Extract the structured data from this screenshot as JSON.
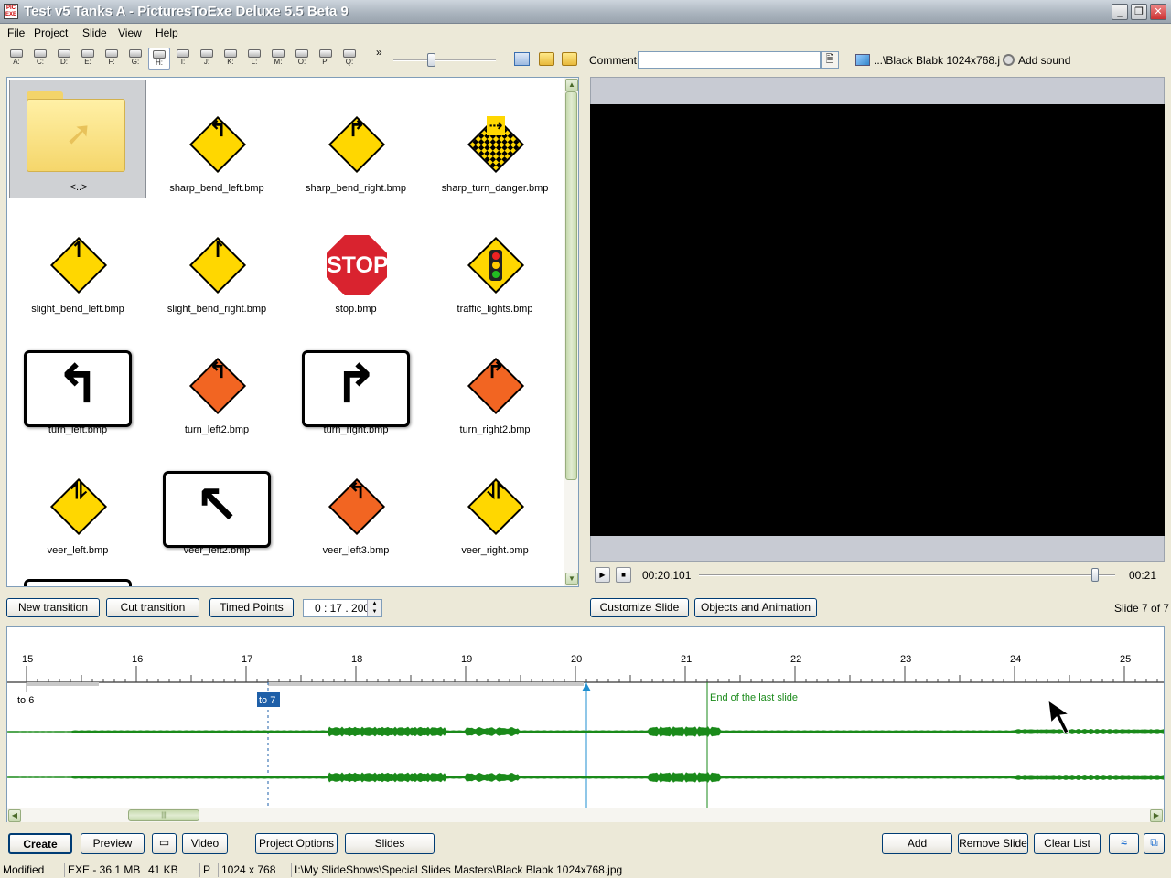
{
  "window": {
    "title": "Test v5 Tanks A - PicturesToExe Deluxe 5.5 Beta 9",
    "icon_text": "PIC EXE"
  },
  "menu": [
    "File",
    "Project",
    "Slide",
    "View",
    "Help"
  ],
  "drives": [
    "A:",
    "C:",
    "D:",
    "E:",
    "F:",
    "G:",
    "H:",
    "I:",
    "J:",
    "K:",
    "L:",
    "M:",
    "O:",
    "P:",
    "Q:"
  ],
  "toolbar": {
    "more": "»",
    "comment_label": "Comment",
    "comment_value": "",
    "background_label": "...\\Black Blabk 1024x768.j",
    "add_sound_label": "Add sound"
  },
  "files": [
    {
      "name": "<..>",
      "kind": "folder"
    },
    {
      "name": "sharp_bend_left.bmp",
      "kind": "yellow",
      "glyph": "↰"
    },
    {
      "name": "sharp_bend_right.bmp",
      "kind": "yellow",
      "glyph": "↱"
    },
    {
      "name": "sharp_turn_danger.bmp",
      "kind": "checker",
      "glyph": "⇢"
    },
    {
      "name": "slight_bend_left.bmp",
      "kind": "yellow",
      "glyph": "↿"
    },
    {
      "name": "slight_bend_right.bmp",
      "kind": "yellow",
      "glyph": "↾"
    },
    {
      "name": "stop.bmp",
      "kind": "stop",
      "glyph": "STOP"
    },
    {
      "name": "traffic_lights.bmp",
      "kind": "lights"
    },
    {
      "name": "turn_left.bmp",
      "kind": "rect",
      "glyph": "↰"
    },
    {
      "name": "turn_left2.bmp",
      "kind": "orange",
      "glyph": "↰"
    },
    {
      "name": "turn_right.bmp",
      "kind": "rect",
      "glyph": "↱"
    },
    {
      "name": "turn_right2.bmp",
      "kind": "orange",
      "glyph": "↱"
    },
    {
      "name": "veer_left.bmp",
      "kind": "yellow",
      "glyph": "⥮"
    },
    {
      "name": "veer_left2.bmp",
      "kind": "rect",
      "glyph": "↖"
    },
    {
      "name": "veer_left3.bmp",
      "kind": "orange",
      "glyph": "↰"
    },
    {
      "name": "veer_right.bmp",
      "kind": "yellow",
      "glyph": "⥯"
    }
  ],
  "colors": {
    "yellow": "#ffd700",
    "orange": "#f26522",
    "stop": "#d9232f",
    "wave": "#1a8a1a",
    "cursor": "#1f8fd0",
    "end": "#1a8a1a",
    "marker_bg": "#1e5fa8"
  },
  "player": {
    "play_icon": "▶",
    "stop_icon": "■",
    "current": "00:20.101",
    "total": "00:21",
    "position": 0.95
  },
  "buttons": {
    "new_transition": "New transition",
    "cut_transition": "Cut transition",
    "timed_points": "Timed Points",
    "duration": "0 : 17 . 200",
    "customize_slide": "Customize Slide",
    "objects_animation": "Objects and Animation",
    "slide_count": "Slide 7 of 7"
  },
  "timeline": {
    "ticks": [
      "15",
      "16",
      "17",
      "18",
      "19",
      "20",
      "21",
      "22",
      "23",
      "24",
      "25"
    ],
    "markers": [
      {
        "label": "to 6",
        "selected": false
      },
      {
        "label": "to 7",
        "selected": true
      }
    ],
    "end_label": "End of the last slide"
  },
  "bottom": {
    "create": "Create",
    "preview": "Preview",
    "video": "Video",
    "project_options": "Project Options",
    "slides": "Slides",
    "add": "Add",
    "remove_slide": "Remove Slide",
    "clear_list": "Clear List"
  },
  "status": {
    "state": "Modified",
    "exe": "EXE - 36.1 MB",
    "size": "41 KB",
    "flag": "P",
    "resolution": "1024 x 768",
    "path": "I:\\My SlideShows\\Special Slides Masters\\Black Blabk 1024x768.jpg"
  }
}
